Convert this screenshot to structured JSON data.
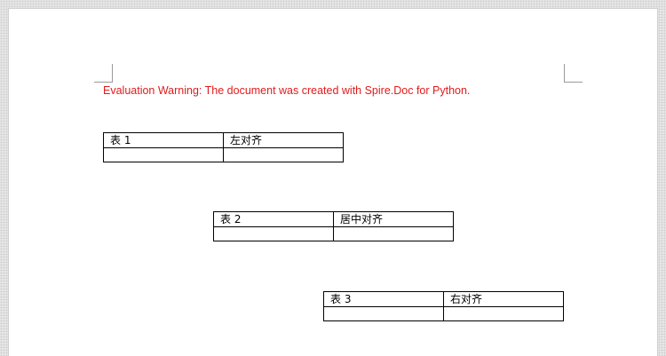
{
  "warning": "Evaluation Warning: The document was created with Spire.Doc for Python.",
  "tables": [
    {
      "align": "left",
      "rows": [
        [
          "表 1",
          "左对齐"
        ],
        [
          "",
          ""
        ]
      ]
    },
    {
      "align": "center",
      "rows": [
        [
          "表 2",
          "居中对齐"
        ],
        [
          "",
          ""
        ]
      ]
    },
    {
      "align": "right",
      "rows": [
        [
          "表 3",
          "右对齐"
        ],
        [
          "",
          ""
        ]
      ]
    }
  ],
  "colors": {
    "warning_text": "#e01b1b",
    "page": "#ffffff",
    "canvas": "#e6e6e6",
    "table_border": "#000000"
  }
}
